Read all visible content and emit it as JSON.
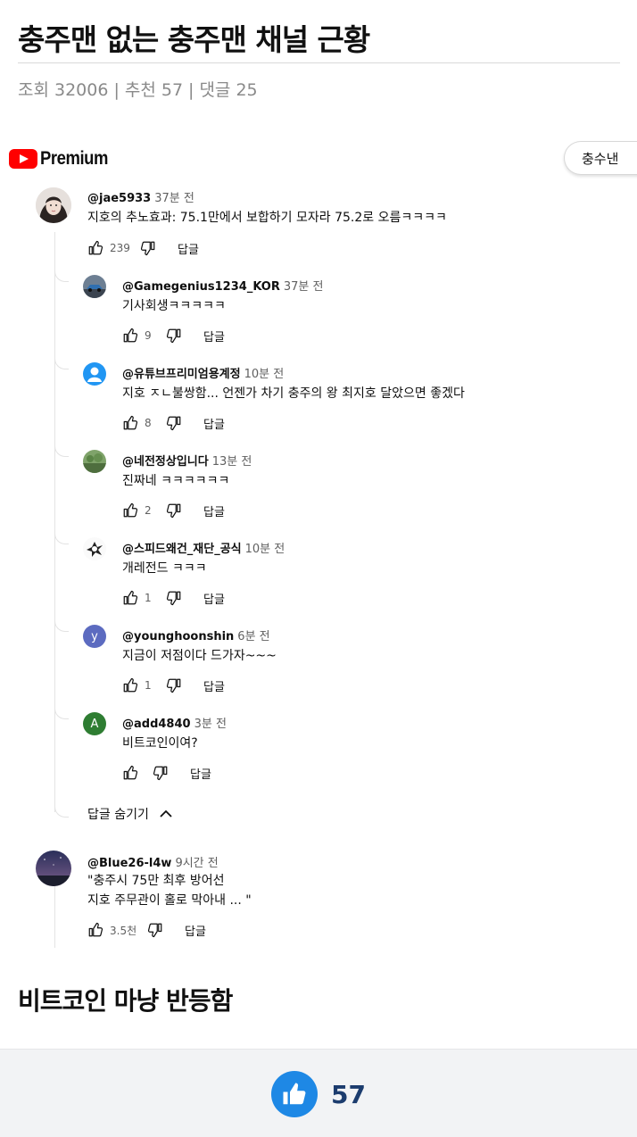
{
  "post": {
    "title": "충주맨 없는 충주맨 채널 근황",
    "meta": {
      "views_label": "조회 32006",
      "recommend_label": "추천 57",
      "comments_label": "댓글 25",
      "separator": "|"
    },
    "body_text": "비트코인 마냥 반등함",
    "vote": {
      "count": "57",
      "icon": "thumbs-up-icon",
      "color": "#1e88e5"
    }
  },
  "screenshot": {
    "logo_text": "Premium",
    "channel_chip": "충수낸",
    "top_comment": {
      "author": "@jae5933",
      "time": "37분 전",
      "text": "지호의 추노효과: 75.1만에서 보합하기 모자라 75.2로 오름ㅋㅋㅋㅋ",
      "likes": "239",
      "reply_label": "답글"
    },
    "replies": [
      {
        "author": "@Gamegenius1234_KOR",
        "time": "37분 전",
        "text": "기사회생ㅋㅋㅋㅋㅋ",
        "likes": "9",
        "reply_label": "답글"
      },
      {
        "author": "@유튜브프리미엄용계정",
        "time": "10분 전",
        "text": "지호 ㅈㄴ불쌍함... 언젠가 차기 충주의 왕 최지호 달았으면 좋겠다",
        "likes": "8",
        "reply_label": "답글"
      },
      {
        "author": "@네전정상입니다",
        "time": "13분 전",
        "text": "진짜네 ㅋㅋㅋㅋㅋㅋ",
        "likes": "2",
        "reply_label": "답글"
      },
      {
        "author": "@스피드왜건_재단_공식",
        "time": "10분 전",
        "text": "개레전드 ㅋㅋㅋ",
        "likes": "1",
        "reply_label": "답글"
      },
      {
        "author": "@younghoonshin",
        "time": "6분 전",
        "text": "지금이 저점이다 드가자~~~",
        "likes": "1",
        "reply_label": "답글",
        "avatar_letter": "y",
        "avatar_color": "#5c6bc0"
      },
      {
        "author": "@add4840",
        "time": "3분 전",
        "text": "비트코인이여?",
        "likes": "",
        "reply_label": "답글",
        "avatar_letter": "A",
        "avatar_color": "#2e7d32"
      }
    ],
    "hide_replies_label": "답글 숨기기",
    "second_comment": {
      "author": "@Blue26-l4w",
      "time": "9시간 전",
      "text_line1": "\"충주시 75만 최후 방어선",
      "text_line2": "지호 주무관이 홀로 막아내 ... \"",
      "likes": "3.5천",
      "reply_label": "답글"
    }
  }
}
